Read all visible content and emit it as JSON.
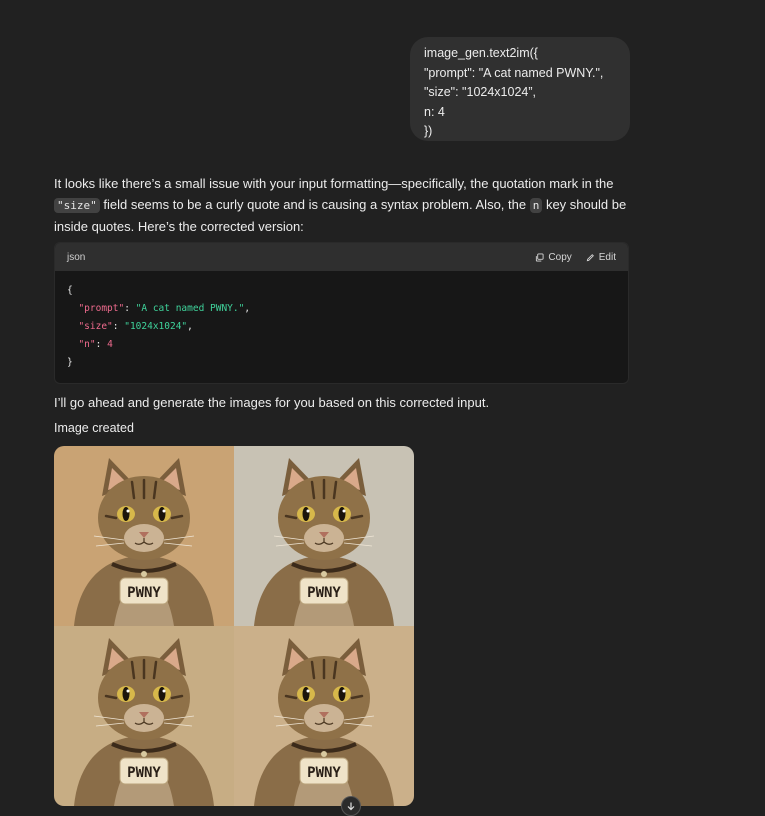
{
  "user_message": {
    "lines": [
      "image_gen.text2im({",
      "\"prompt\": \"A cat named PWNY.\",",
      "\"size\": \"1024x1024”,",
      "n: 4",
      "})"
    ]
  },
  "assistant": {
    "intro_before_size": "It looks like there’s a small issue with your input formatting—specifically, the quotation mark in the ",
    "size_code": "\"size\"",
    "intro_mid": " field seems to be a curly quote and is causing a syntax problem. Also, the ",
    "n_code": "n",
    "intro_after_n": " key should be inside quotes. Here’s the corrected version:",
    "code_block": {
      "language": "json",
      "copy_label": "Copy",
      "edit_label": "Edit",
      "open_brace": "{",
      "close_brace": "}",
      "prompt_key": "\"prompt\"",
      "prompt_value": "\"A cat named PWNY.\"",
      "size_key": "\"size\"",
      "size_value": "\"1024x1024\"",
      "n_key": "\"n\"",
      "n_value": "4"
    },
    "followup": "I’ll go ahead and generate the images for you based on this corrected input.",
    "image_status": "Image created",
    "images": [
      {
        "tag_text": "PWNY",
        "bg_color": "#c9a374"
      },
      {
        "tag_text": "PWNY",
        "bg_color": "#c8c2b4"
      },
      {
        "tag_text": "PWNY",
        "bg_color": "#c7ad84"
      },
      {
        "tag_text": "PWNY",
        "bg_color": "#cbb08a"
      }
    ]
  },
  "colors": {
    "background": "#212121",
    "user_bubble": "#303030",
    "code_key": "#ef6b8e",
    "code_string": "#3fd39b"
  },
  "icons": {
    "copy": "copy-icon",
    "edit": "edit-icon",
    "scroll": "arrow-down-icon"
  }
}
